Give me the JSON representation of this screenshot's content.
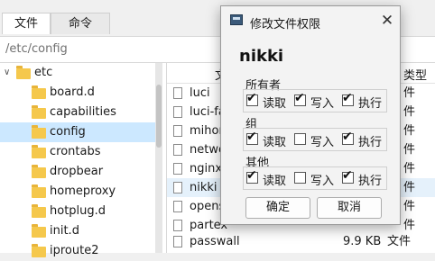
{
  "tabs": [
    {
      "label": "文件",
      "active": true
    },
    {
      "label": "命令",
      "active": false
    }
  ],
  "path": "/etc/config",
  "tree": {
    "root": {
      "label": "etc",
      "expanded": true
    },
    "children": [
      {
        "label": "board.d",
        "selected": false
      },
      {
        "label": "capabilities",
        "selected": false
      },
      {
        "label": "config",
        "selected": true
      },
      {
        "label": "crontabs",
        "selected": false
      },
      {
        "label": "dropbear",
        "selected": false
      },
      {
        "label": "homeproxy",
        "selected": false
      },
      {
        "label": "hotplug.d",
        "selected": false
      },
      {
        "label": "init.d",
        "selected": false
      },
      {
        "label": "iproute2",
        "selected": false
      }
    ]
  },
  "files": {
    "header": {
      "name_frag": "文",
      "type_frag": "类型"
    },
    "rows": [
      {
        "name": "luci",
        "size": "",
        "type": "件"
      },
      {
        "name": "luci-fa",
        "size": "",
        "type": "件"
      },
      {
        "name": "mihor",
        "size": "",
        "type": "件"
      },
      {
        "name": "netwo",
        "size": "",
        "type": "件"
      },
      {
        "name": "nginx",
        "size": "",
        "type": "件"
      },
      {
        "name": "nikki",
        "size": "",
        "type": "件",
        "selected": true
      },
      {
        "name": "opens",
        "size": "",
        "type": "件"
      },
      {
        "name": "partex",
        "size": "",
        "type": "件"
      },
      {
        "name": "passwall",
        "size": "9.9 KB",
        "type": "文件"
      }
    ]
  },
  "dialog": {
    "title": "修改文件权限",
    "filename": "nikki",
    "close_glyph": "✕",
    "groups": [
      {
        "label": "所有者",
        "read": {
          "label": "读取",
          "checked": true
        },
        "write": {
          "label": "写入",
          "checked": true
        },
        "exec": {
          "label": "执行",
          "checked": true
        }
      },
      {
        "label": "组",
        "read": {
          "label": "读取",
          "checked": true
        },
        "write": {
          "label": "写入",
          "checked": false
        },
        "exec": {
          "label": "执行",
          "checked": true
        }
      },
      {
        "label": "其他",
        "read": {
          "label": "读取",
          "checked": true
        },
        "write": {
          "label": "写入",
          "checked": false
        },
        "exec": {
          "label": "执行",
          "checked": true
        }
      }
    ],
    "ok_label": "确定",
    "cancel_label": "取消"
  },
  "colors": {
    "folder": "#f5c84c",
    "selection": "#cce8ff",
    "accent": "#0067c0"
  }
}
